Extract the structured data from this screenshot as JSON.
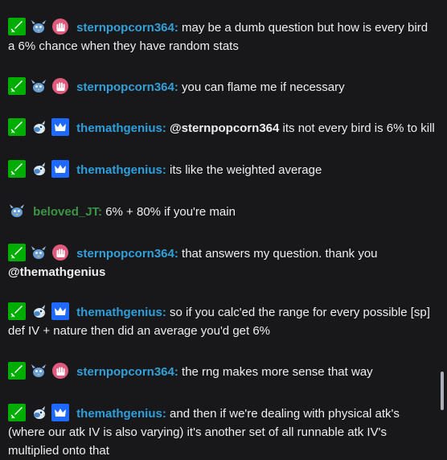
{
  "colors": {
    "background": "#18181b",
    "user_sternpopcorn364": "#33a0d8",
    "user_themathgenius": "#2e9fdc",
    "user_beloved_jt": "#3d9444",
    "text": "#efeff1"
  },
  "icons": {
    "moderator": "green-sword-icon",
    "bird_blue": "blue-bird-icon",
    "bird_white": "white-bird-icon",
    "subscriber_hand": "pink-hand-badge-icon",
    "vip_crown": "blue-crown-icon"
  },
  "messages": [
    {
      "user": "sternpopcorn364",
      "separator": ":",
      "text": " may be a dumb question but how is every bird a 6% chance when they have random stats"
    },
    {
      "user": "sternpopcorn364",
      "separator": ":",
      "text": " you can flame me if necessary"
    },
    {
      "user": "themathgenius",
      "separator": ":",
      "mention": "@sternpopcorn364",
      "text": " its not every bird is 6% to kill"
    },
    {
      "user": "themathgenius",
      "separator": ":",
      "text": " its like the weighted average"
    },
    {
      "user": "beloved_JT",
      "separator": ":",
      "text": " 6% + 80% if you're main"
    },
    {
      "user": "sternpopcorn364",
      "separator": ":",
      "text": " that answers my question. thank you ",
      "mention": "@themathgenius"
    },
    {
      "user": "themathgenius",
      "separator": ":",
      "text": " so if you calc'ed the range for every possible [sp] def IV + nature then did an average you'd get 6%"
    },
    {
      "user": "sternpopcorn364",
      "separator": ":",
      "text": " the rng makes more sense that way"
    },
    {
      "user": "themathgenius",
      "separator": ":",
      "text": " and then if we're dealing with physical atk's (where our atk IV is also varying) it's another set of all runnable atk IV's multiplied onto that"
    }
  ]
}
